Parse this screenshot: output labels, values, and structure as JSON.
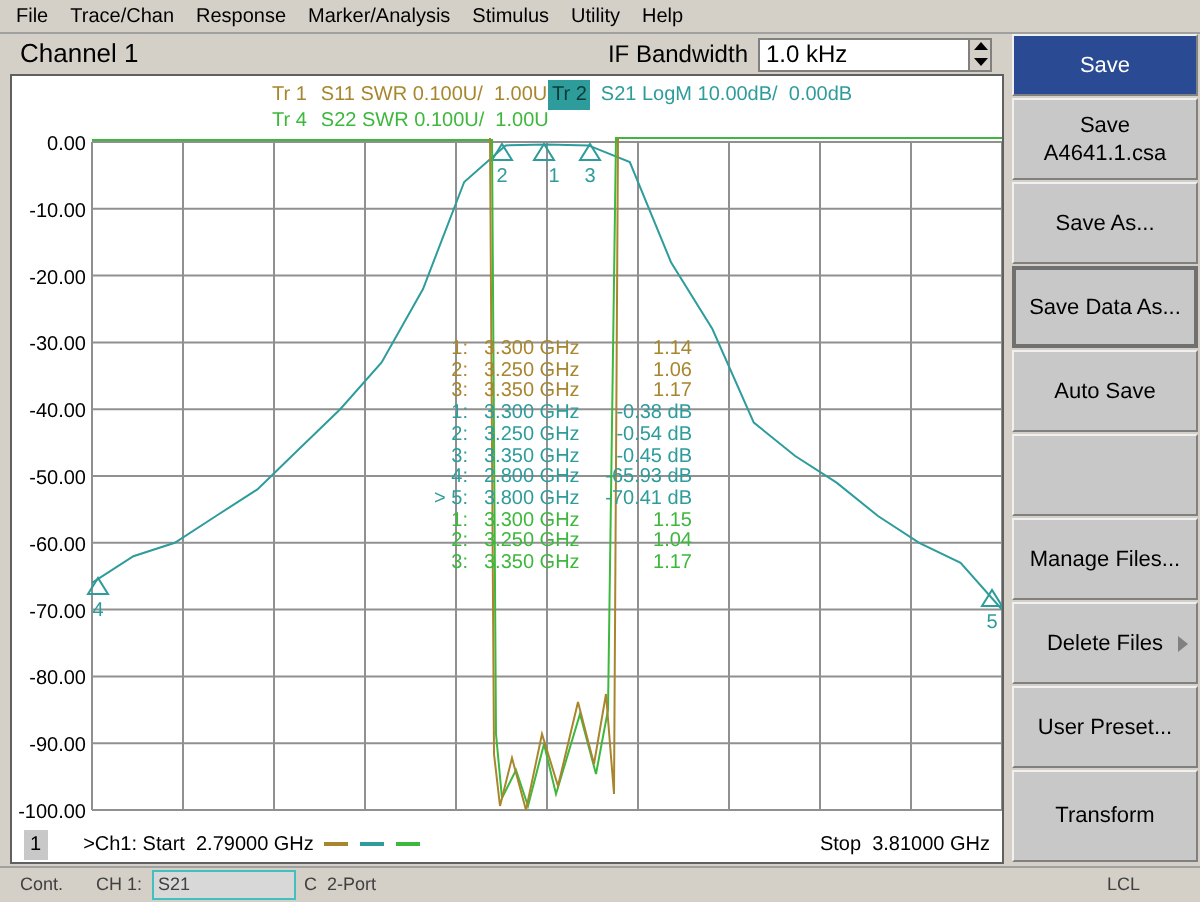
{
  "menu": [
    "File",
    "Trace/Chan",
    "Response",
    "Marker/Analysis",
    "Stimulus",
    "Utility",
    "Help"
  ],
  "channel_title": "Channel 1",
  "if_bandwidth": {
    "label": "IF Bandwidth",
    "value": "1.0 kHz"
  },
  "traces": [
    {
      "label": "Tr 1",
      "text": "S11 SWR 0.100U/  1.00U",
      "color": "#a8862e",
      "selected": false
    },
    {
      "label": "Tr 2",
      "text": "S21 LogM 10.00dB/  0.00dB",
      "color": "#2f9c9c",
      "selected": true
    },
    {
      "label": "Tr 4",
      "text": "S22 SWR 0.100U/  1.00U",
      "color": "#3db83d",
      "selected": false
    }
  ],
  "markers": [
    {
      "number": "1:",
      "frequency": "3.300 GHz",
      "value": "1.14",
      "color": "#a8862e"
    },
    {
      "number": "2:",
      "frequency": "3.250 GHz",
      "value": "1.06",
      "color": "#a8862e"
    },
    {
      "number": "3:",
      "frequency": "3.350 GHz",
      "value": "1.17",
      "color": "#a8862e"
    },
    {
      "number": "1:",
      "frequency": "3.300 GHz",
      "value": "-0.38 dB",
      "color": "#2f9c9c"
    },
    {
      "number": "2:",
      "frequency": "3.250 GHz",
      "value": "-0.54 dB",
      "color": "#2f9c9c"
    },
    {
      "number": "3:",
      "frequency": "3.350 GHz",
      "value": "-0.45 dB",
      "color": "#2f9c9c"
    },
    {
      "number": "4:",
      "frequency": "2.800 GHz",
      "value": "-65.93 dB",
      "color": "#2f9c9c"
    },
    {
      "number": "> 5:",
      "frequency": "3.800 GHz",
      "value": "-70.41 dB",
      "color": "#2f9c9c"
    },
    {
      "number": "1:",
      "frequency": "3.300 GHz",
      "value": "1.15",
      "color": "#3db83d"
    },
    {
      "number": "2:",
      "frequency": "3.250 GHz",
      "value": "1.04",
      "color": "#3db83d"
    },
    {
      "number": "3:",
      "frequency": "3.350 GHz",
      "value": "1.17",
      "color": "#3db83d"
    }
  ],
  "chart_data": {
    "type": "line",
    "categories": [
      null,
      null,
      null,
      null,
      null,
      null,
      null,
      null,
      null,
      null,
      null,
      null,
      null,
      null,
      null,
      null,
      null,
      null,
      null,
      null,
      null,
      null,
      null
    ],
    "series": [
      {
        "color": "#2f9c9c",
        "values": [
          -66,
          -62,
          -60,
          -56,
          -52,
          -46,
          -40,
          -33,
          -22,
          -6,
          -0.5,
          -0.4,
          -0.5,
          -3,
          -18,
          -28,
          -42,
          -47,
          -51,
          -56,
          -60,
          -63,
          -70
        ]
      }
    ],
    "ylim": [
      -100,
      0
    ],
    "grid": true,
    "yticks": [
      {
        "value": 0,
        "label": "0.00"
      },
      {
        "value": -10,
        "label": "-10.00"
      },
      {
        "value": -20,
        "label": "-20.00"
      },
      {
        "value": -30,
        "label": "-30.00"
      },
      {
        "value": -40,
        "label": "-40.00"
      },
      {
        "value": -50,
        "label": "-50.00"
      },
      {
        "value": -60,
        "label": "-60.00"
      },
      {
        "value": -70,
        "label": "-70.00"
      },
      {
        "value": -80,
        "label": "-80.00"
      },
      {
        "value": -90,
        "label": "-90.00"
      },
      {
        "value": -100,
        "label": "-100.00"
      }
    ]
  },
  "trace_markers": [
    {
      "label": "2"
    },
    {
      "label": "1"
    },
    {
      "label": "3"
    },
    {
      "label": "4"
    },
    {
      "label": "5"
    }
  ],
  "sweep": {
    "channel_box": "1",
    "start": ">Ch1: Start  2.79000 GHz",
    "stop": "Stop  3.81000 GHz"
  },
  "softkeys": [
    {
      "lines": [
        "Save"
      ],
      "selected": true,
      "focused": false,
      "submenu": false
    },
    {
      "lines": [
        "Save",
        "A4641.1.csa"
      ],
      "selected": false,
      "focused": false,
      "submenu": false
    },
    {
      "lines": [
        "Save As..."
      ],
      "selected": false,
      "focused": false,
      "submenu": false
    },
    {
      "lines": [
        "Save Data As..."
      ],
      "selected": false,
      "focused": true,
      "submenu": false
    },
    {
      "lines": [
        "Auto Save"
      ],
      "selected": false,
      "focused": false,
      "submenu": false
    },
    {
      "selected": false,
      "focused": false,
      "submenu": false
    },
    {
      "lines": [
        "Manage Files..."
      ],
      "selected": false,
      "focused": false,
      "submenu": false
    },
    {
      "lines": [
        "Delete Files"
      ],
      "selected": false,
      "focused": false,
      "submenu": true
    },
    {
      "lines": [
        "User Preset..."
      ],
      "selected": false,
      "focused": false,
      "submenu": false
    },
    {
      "lines": [
        "Transform"
      ],
      "selected": false,
      "focused": false,
      "submenu": false
    }
  ],
  "status_bar": {
    "mode": "Cont.",
    "channel": "CH 1:",
    "measurement": "S21",
    "calibration": "C  2-Port",
    "remote": "LCL"
  }
}
